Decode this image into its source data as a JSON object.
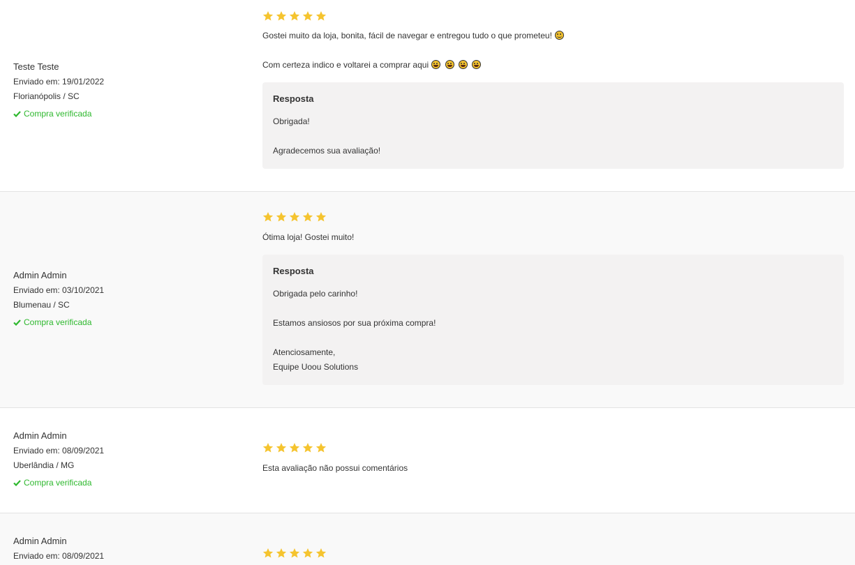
{
  "reviews": [
    {
      "author": "Teste Teste",
      "sent": "Enviado em: 19/01/2022",
      "location": "Florianópolis / SC",
      "verified": "Compra verificada",
      "rating": 5,
      "comment_line1": "Gostei muito da loja, bonita, fácil de navegar e entregou tudo o que prometeu!",
      "comment_line2": "Com certeza indico e voltarei a comprar aqui",
      "reply_title": "Resposta",
      "reply_lines": [
        "Obrigada!",
        "Agradecemos sua avaliação!"
      ]
    },
    {
      "author": "Admin Admin",
      "sent": "Enviado em: 03/10/2021",
      "location": "Blumenau / SC",
      "verified": "Compra verificada",
      "rating": 5,
      "comment_line1": "Ótima loja! Gostei muito!",
      "reply_title": "Resposta",
      "reply_lines": [
        "Obrigada pelo carinho!",
        "Estamos ansiosos por sua próxima compra!",
        "Atenciosamente,",
        "Equipe Uoou Solutions"
      ]
    },
    {
      "author": "Admin Admin",
      "sent": "Enviado em: 08/09/2021",
      "location": "Uberlândia / MG",
      "verified": "Compra verificada",
      "rating": 5,
      "comment_line1": "Esta avaliação não possui comentários"
    },
    {
      "author": "Admin Admin",
      "sent": "Enviado em: 08/09/2021",
      "rating": 5
    }
  ],
  "colors": {
    "star": "#f5c42f",
    "verified": "#2eb82e",
    "reply_bg": "#f3f2f2",
    "alt_row_bg": "#f9f9f9"
  }
}
